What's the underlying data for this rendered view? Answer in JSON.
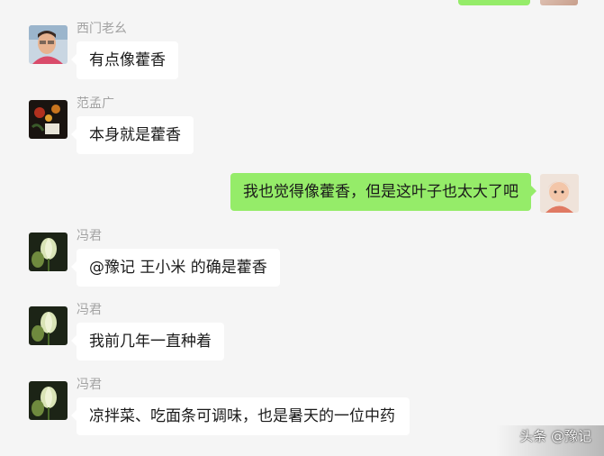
{
  "colors": {
    "background": "#f5f5f5",
    "bubble_other": "#ffffff",
    "bubble_self": "#95ec69",
    "sender_name": "#a3a3a3"
  },
  "messages": [
    {
      "sender": "西门老幺",
      "text": "有点像藿香",
      "avatar_icon": "man-photo-avatar-icon"
    },
    {
      "sender": "范孟广",
      "text": "本身就是藿香",
      "avatar_icon": "night-flower-avatar-icon"
    },
    {
      "self": true,
      "text": "我也觉得像藿香，但是这叶子也太大了吧",
      "avatar_icon": "baby-photo-avatar-icon"
    },
    {
      "sender": "冯君",
      "text": "@豫记 王小米 的确是藿香",
      "avatar_icon": "lotus-bud-avatar-icon"
    },
    {
      "sender": "冯君",
      "text": "我前几年一直种着",
      "avatar_icon": "lotus-bud-avatar-icon"
    },
    {
      "sender": "冯君",
      "text": "凉拌菜、吃面条可调味，也是暑天的一位中药",
      "avatar_icon": "lotus-bud-avatar-icon"
    }
  ],
  "watermark": "头条 @豫记"
}
